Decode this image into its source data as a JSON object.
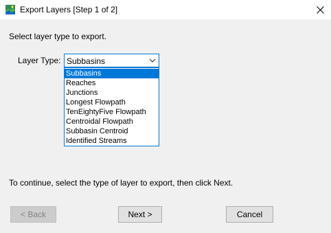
{
  "window": {
    "title": "Export Layers [Step 1 of 2]"
  },
  "instruction": "Select layer type to export.",
  "layer_type": {
    "label": "Layer Type:",
    "selected": "Subbasins",
    "options": [
      "Subbasins",
      "Reaches",
      "Junctions",
      "Longest Flowpath",
      "TenEightyFive Flowpath",
      "Centroidal Flowpath",
      "Subbasin Centroid",
      "Identified Streams"
    ],
    "highlighted_index": 0
  },
  "hint": "To continue, select the type of layer to export, then click Next.",
  "buttons": {
    "back": "< Back",
    "next": "Next >",
    "cancel": "Cancel"
  },
  "colors": {
    "selection": "#0078d7",
    "dialog_background": "#f0f0f0"
  },
  "icons": {
    "app": "map-layers-icon",
    "close": "close-icon",
    "dropdown": "chevron-down-icon"
  }
}
